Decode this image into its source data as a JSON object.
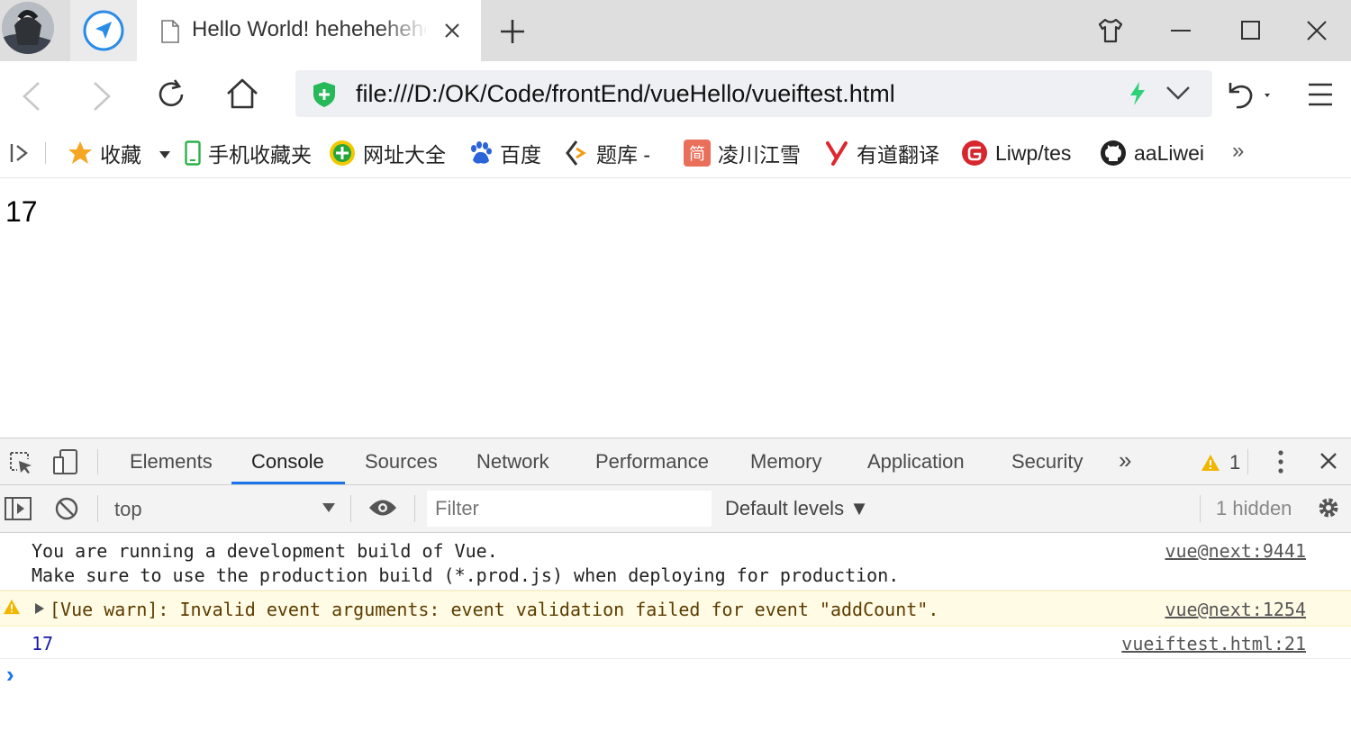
{
  "browser": {
    "tab": {
      "title": "Hello World! hehehehehe"
    },
    "address_url": "file:///D:/OK/Code/frontEnd/vueHello/vueiftest.html",
    "bookmarks": [
      {
        "label": "收藏",
        "icon": "star-icon"
      },
      {
        "label": "手机收藏夹",
        "icon": "phone-icon"
      },
      {
        "label": "网址大全",
        "icon": "site-directory-icon"
      },
      {
        "label": "百度",
        "icon": "baidu-paw-icon"
      },
      {
        "label": "题库 -",
        "icon": "tiku-icon"
      },
      {
        "label": "凌川江雪",
        "icon": "jianshu-icon"
      },
      {
        "label": "有道翻译",
        "icon": "youdao-icon"
      },
      {
        "label": "Liwp/tes",
        "icon": "gitee-icon"
      },
      {
        "label": "aaLiwei",
        "icon": "github-icon"
      }
    ],
    "bookmarks_overflow": "»"
  },
  "page": {
    "number_text": "17"
  },
  "devtools": {
    "tabs": [
      "Elements",
      "Console",
      "Sources",
      "Network",
      "Performance",
      "Memory",
      "Application",
      "Security"
    ],
    "active_tab": "Console",
    "more_tabs": "»",
    "warning_count": "1",
    "context": "top",
    "filter_placeholder": "Filter",
    "levels_label": "Default levels ▼",
    "hidden_label": "1 hidden",
    "messages": [
      {
        "level": "info",
        "lines": [
          "You are running a development build of Vue.",
          "Make sure to use the production build (*.prod.js) when deploying for production."
        ],
        "source": "vue@next:9441"
      },
      {
        "level": "warning",
        "text": "[Vue warn]: Invalid event arguments: event validation failed for event \"addCount\".",
        "source": "vue@next:1254"
      },
      {
        "level": "log",
        "text": "17",
        "source": "vueiftest.html:21"
      }
    ],
    "prompt": "›"
  },
  "colors": {
    "accent": "#1a73e8",
    "warning_bg": "#fffbe5",
    "warning_text": "#5c3c00",
    "log_value": "#1a1aa6",
    "tab_strip": "#dedede"
  }
}
